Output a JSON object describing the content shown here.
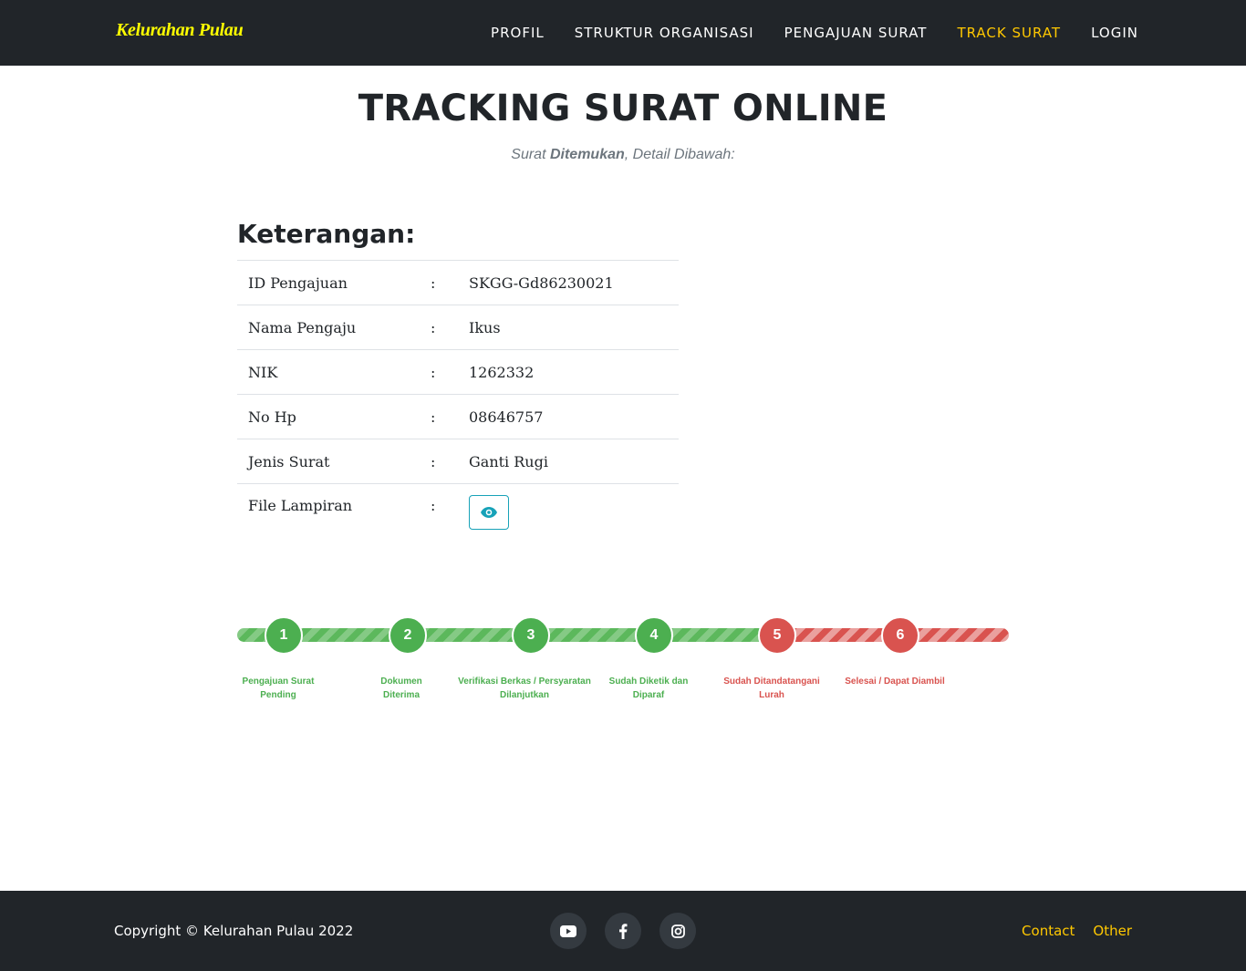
{
  "brand": "Kelurahan Pulau",
  "nav": {
    "items": [
      {
        "label": "PROFIL"
      },
      {
        "label": "STRUKTUR ORGANISASI"
      },
      {
        "label": "PENGAJUAN SURAT"
      },
      {
        "label": "TRACK SURAT",
        "active": true
      },
      {
        "label": "LOGIN"
      }
    ]
  },
  "header": {
    "title": "TRACKING SURAT ONLINE",
    "subtitle_prefix": "Surat ",
    "subtitle_bold": "Ditemukan",
    "subtitle_suffix": ", Detail Dibawah:"
  },
  "details": {
    "title": "Keterangan:",
    "separator": ":",
    "rows": [
      {
        "label": "ID Pengajuan",
        "value": "SKGG-Gd86230021"
      },
      {
        "label": "Nama Pengaju",
        "value": "Ikus"
      },
      {
        "label": "NIK",
        "value": "1262332"
      },
      {
        "label": "No Hp",
        "value": "08646757"
      },
      {
        "label": "Jenis Surat",
        "value": "Ganti Rugi"
      },
      {
        "label": "File Lampiran",
        "value_icon": "eye-icon"
      }
    ]
  },
  "progress": {
    "current_step": 4,
    "total_steps": 6,
    "colors": {
      "done": "#4caf50",
      "pending": "#d9534f"
    },
    "steps": [
      {
        "number": "1",
        "label_line1": "Pengajuan Surat",
        "label_line2": "Pending",
        "status": "done"
      },
      {
        "number": "2",
        "label_line1": "Dokumen",
        "label_line2": "Diterima",
        "status": "done"
      },
      {
        "number": "3",
        "label_line1": "Verifikasi Berkas / Persyaratan",
        "label_line2": "Dilanjutkan",
        "status": "done"
      },
      {
        "number": "4",
        "label_line1": "Sudah Diketik dan",
        "label_line2": "Diparaf",
        "status": "done"
      },
      {
        "number": "5",
        "label_line1": "Sudah Ditandatangani",
        "label_line2": "Lurah",
        "status": "pending"
      },
      {
        "number": "6",
        "label_line1": "Selesai / Dapat Diambil",
        "label_line2": "",
        "status": "pending"
      }
    ]
  },
  "footer": {
    "copyright": "Copyright © Kelurahan Pulau 2022",
    "social_icons": [
      "youtube-icon",
      "facebook-icon",
      "instagram-icon"
    ],
    "links": [
      {
        "label": "Contact"
      },
      {
        "label": "Other"
      }
    ]
  },
  "colors": {
    "navbar_bg": "#212529",
    "brand": "#ffff00",
    "accent": "#ffc800",
    "info": "#17a2b8"
  }
}
